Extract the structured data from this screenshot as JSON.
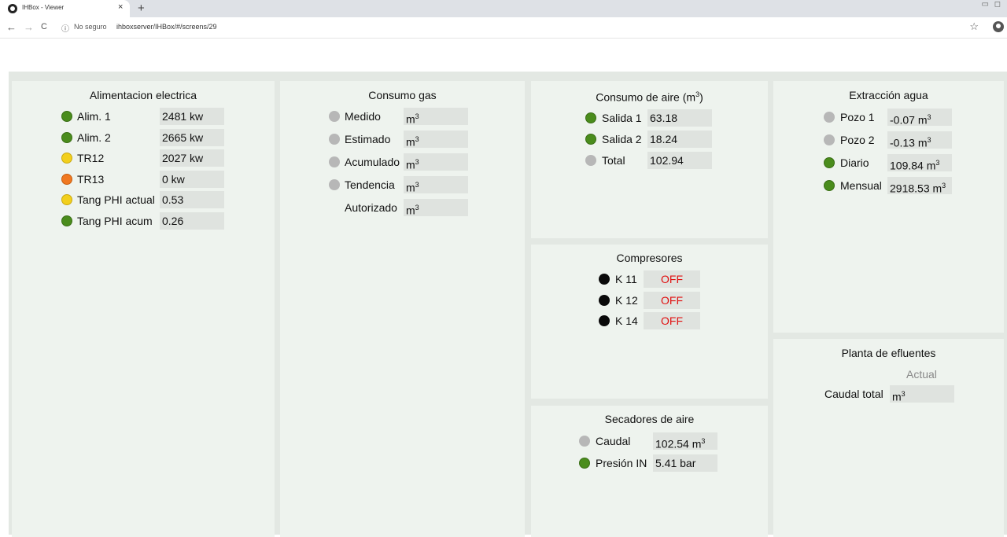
{
  "browser": {
    "tab_title": "IHBox - Viewer",
    "tab_close": "×",
    "new_tab": "+",
    "secure_label": "No seguro",
    "url": "ihboxserver/IHBox/#/screens/29",
    "back": "←",
    "forward": "→",
    "reload": "C",
    "info_icon": "ⓘ",
    "star_icon": "☆"
  },
  "alimentacion": {
    "title": "Alimentacion electrica",
    "rows": [
      {
        "label": "Alim. 1",
        "value": "2481 kw",
        "status": "green"
      },
      {
        "label": "Alim. 2",
        "value": "2665 kw",
        "status": "green"
      },
      {
        "label": "TR12",
        "value": "2027 kw",
        "status": "yellow"
      },
      {
        "label": "TR13",
        "value": "0 kw",
        "status": "orange"
      },
      {
        "label": "Tang PHI actual",
        "value": "0.53",
        "status": "yellow"
      },
      {
        "label": "Tang PHI acum",
        "value": "0.26",
        "status": "green"
      }
    ]
  },
  "gas": {
    "title": "Consumo gas",
    "unit": "m",
    "unit_exp": "3",
    "rows": [
      {
        "label": "Medido",
        "status": "grey"
      },
      {
        "label": "Estimado",
        "status": "grey"
      },
      {
        "label": "Acumulado",
        "status": "grey"
      },
      {
        "label": "Tendencia",
        "status": "grey"
      },
      {
        "label": "Autorizado",
        "status": "none"
      }
    ]
  },
  "aire": {
    "title": "Consumo de aire (m",
    "title_exp": "3",
    "title_end": ")",
    "rows": [
      {
        "label": "Salida 1",
        "value": "63.18",
        "status": "green"
      },
      {
        "label": "Salida 2",
        "value": "18.24",
        "status": "green"
      },
      {
        "label": "Total",
        "value": "102.94",
        "status": "grey"
      }
    ]
  },
  "agua": {
    "title": "Extracción agua",
    "unit": "m",
    "unit_exp": "3",
    "rows": [
      {
        "label": "Pozo 1",
        "value": "-0.07",
        "status": "grey"
      },
      {
        "label": "Pozo 2",
        "value": "-0.13",
        "status": "grey"
      },
      {
        "label": "Diario",
        "value": "109.84",
        "status": "green"
      },
      {
        "label": "Mensual",
        "value": "2918.53",
        "status": "green"
      }
    ]
  },
  "compresores": {
    "title": "Compresores",
    "rows": [
      {
        "label": "K 11",
        "value": "OFF",
        "status": "black"
      },
      {
        "label": "K 12",
        "value": "OFF",
        "status": "black"
      },
      {
        "label": "K 14",
        "value": "OFF",
        "status": "black"
      }
    ]
  },
  "efluentes": {
    "title": "Planta de efluentes",
    "subhead": "Actual",
    "row_label": "Caudal total",
    "unit": "m",
    "unit_exp": "3"
  },
  "secadores": {
    "title": "Secadores de aire",
    "rows": [
      {
        "label": "Caudal",
        "value": "102.54",
        "unit": "m",
        "unit_exp": "3",
        "status": "grey"
      },
      {
        "label": "Presión IN",
        "value": "5.41 bar",
        "status": "green"
      }
    ]
  },
  "colors": {
    "ok": "#4a8c1c",
    "warn": "#f2cf1c",
    "alert": "#f07820",
    "inactive": "#b7b7b7",
    "off_text": "#e01010",
    "panel_bg": "#eef3ee"
  }
}
